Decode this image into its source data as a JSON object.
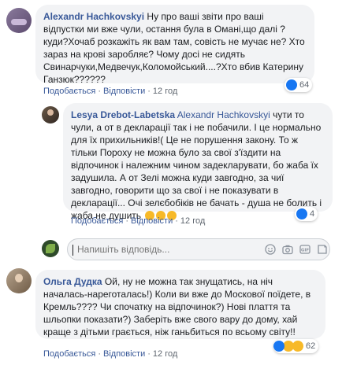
{
  "comment1": {
    "author": "Alexandr Hachkovskyi",
    "text": "Ну про ваші звіти про ваші відпустки ми вже чули, остання була в Омані,що далі ?куди?Хочаб розкажіть як вам там, совість не мучає не? Хто зараз на крові заробляє? Чому досі не сидять Свинарчуки,Медвечук,Коломойський....?Хто вбив Катерину Ганзюк??????",
    "like_label": "Подобається",
    "reply_label": "Відповісти",
    "time": "12 год",
    "reaction_count": "64"
  },
  "comment2": {
    "author": "Lesya Drebot-Labetska",
    "mention": "Alexandr Hachkovskyi",
    "text": "чути то чули, а от в декларації так і не побачили. І це нормально для їх прихильників!( Це не порушення закону. То ж тільки Пороху не можна було за свої з'їздити на відпочинок і належним чином задекларувати, бо жаба їх задушила. А от Зелі можна куди завгодно, за чиї завгодно, говорити що за свої і не показувати в декларації... Очі зелєбобіків не бачать - душа не болить і жаба не душить",
    "like_label": "Подобається",
    "reply_label": "Відповісти",
    "time": "12 год",
    "reaction_count": "4"
  },
  "reply_box": {
    "placeholder": "Напишіть відповідь..."
  },
  "comment3": {
    "author": "Ольга Дудка",
    "text": "Ой, ну не можна так знущатись, на ніч началась-нареготалась!) Коли ви вже до Москової поїдете, в Кремль???? Чи спочатку на відпочинок?) Нові плаття та шльопки показати?) Заберіть вже свого вару до дому, хай краще з дітьми грається, ніж ганьбиться по всьому світу!!",
    "like_label": "Подобається",
    "reply_label": "Відповісти",
    "time": "12 год",
    "reaction_count": "62"
  },
  "colors": {
    "link": "#385898",
    "bubble": "#f2f3f5",
    "like_blue": "#1877f2",
    "emoji_yellow": "#f7b928"
  }
}
